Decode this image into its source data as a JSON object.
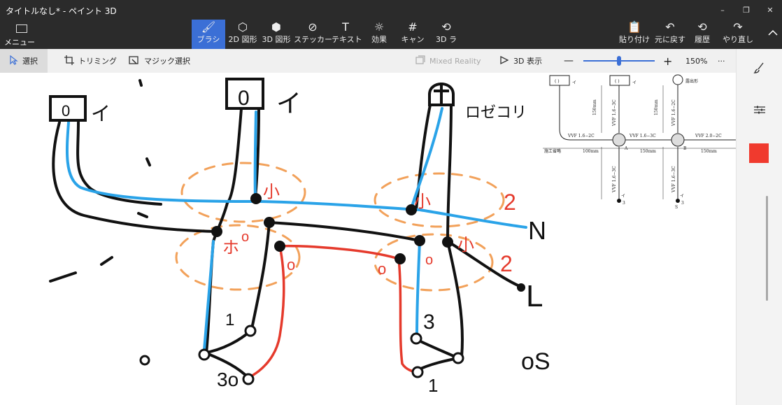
{
  "window": {
    "title": "タイトルなし* - ペイント 3D",
    "controls": [
      "–",
      "❐",
      "✕"
    ]
  },
  "ribbon": {
    "menu_label": "メニュー",
    "tools": [
      {
        "glyph": "🖌",
        "label": "ブラシ",
        "active": true
      },
      {
        "glyph": "⬡",
        "label": "2D 図形"
      },
      {
        "glyph": "⬢",
        "label": "3D 図形"
      },
      {
        "glyph": "⊘",
        "label": "ステッカー"
      },
      {
        "glyph": "T",
        "label": "テキスト"
      },
      {
        "glyph": "☼",
        "label": "効果"
      },
      {
        "glyph": "#",
        "label": "キャン"
      },
      {
        "glyph": "⟲",
        "label": "3D ラ"
      }
    ],
    "actions": [
      {
        "glyph": "📋",
        "label": "貼り付け"
      },
      {
        "glyph": "↶",
        "label": "元に戻す"
      },
      {
        "glyph": "⟲",
        "label": "履歴"
      },
      {
        "glyph": "↷",
        "label": "やり直し"
      }
    ],
    "collapse_icon": "chevron-up-icon"
  },
  "toolbar": {
    "select_label": "選択",
    "crop_label": "トリミング",
    "magic_label": "マジック選択",
    "mixed_reality_label": "Mixed Reality",
    "view3d_label": "3D 表示",
    "zoom_minus": "—",
    "zoom_plus": "+",
    "zoom_value": "150%",
    "zoom_level": 0.5,
    "more": "···"
  },
  "side_panel": {
    "brush_icon": "brush-icon",
    "settings_icon": "sliders-icon",
    "current_color": "#f03a2e"
  },
  "colors": {
    "accent": "#3b6fd6",
    "ink_black": "#111111",
    "ink_blue": "#2aa3e8",
    "ink_red": "#e53a2c",
    "ink_orange": "#f2a15a"
  },
  "drawing": {
    "labels": {
      "switch_left": "イ",
      "switch_mid": "イ",
      "rosette": "ロゼコリ",
      "N": "N",
      "L": "L",
      "os": "oS",
      "o_left": "o",
      "three_left": "3o",
      "three_right": "3",
      "one_left": "1",
      "one_right": "1",
      "small1": "小",
      "small2": "小",
      "small3": "小",
      "ho": "ホ",
      "two1": "2",
      "two2": "2",
      "o1": "o",
      "o2": "o"
    }
  },
  "reference": {
    "box1": "( )",
    "box2": "( )",
    "i1": "イ",
    "i2": "イ",
    "rosette_label": "露出形",
    "vvf_a": "VVF 1.6−2C",
    "vvf_b": "VVF 1.6−3C",
    "vvf_c": "VVF 2.0−2C",
    "v150a": "150mm",
    "v150b": "150mm",
    "vvf_v1": "VVF 1.6−3C",
    "vvf_v2": "VVF 1.6−2C",
    "vvf_v3": "VVF 1.6−3C",
    "vvf_v4": "VVF 1.6−3C",
    "construct": "施工省略",
    "h100": "100mm",
    "h150a": "150mm",
    "h150b": "150mm",
    "pt_a": "A",
    "pt_b": "B",
    "bottom_s": "S",
    "bottom_3a": "3",
    "bottom_3b": "3",
    "bottom_i": "イ",
    "bottom_i2": "イ"
  }
}
